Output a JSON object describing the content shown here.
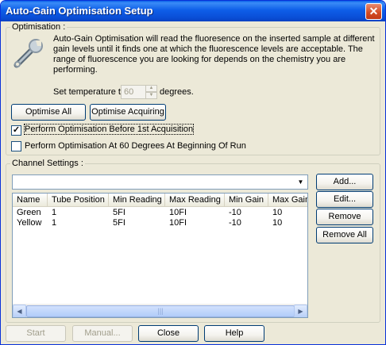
{
  "window": {
    "title": "Auto-Gain Optimisation Setup",
    "close_glyph": "✕"
  },
  "optimisation": {
    "group_label": "Optimisation :",
    "description": "Auto-Gain Optimisation will read the fluoresence on the inserted sample at different gain levels until it finds one at which the fluorescence levels are acceptable. The range of fluorescence you are looking for depends on the chemistry you are performing.",
    "temp_label": "Set temperature to",
    "temp_value": "60",
    "temp_units": "degrees.",
    "optimise_all": "Optimise All",
    "optimise_acquiring": "Optimise Acquiring",
    "check_before": {
      "label": "Perform Optimisation Before 1st Acquisition",
      "checked": true
    },
    "check_at_60": {
      "label": "Perform Optimisation At 60 Degrees At Beginning Of Run",
      "checked": false
    }
  },
  "channel": {
    "group_label": "Channel Settings :",
    "combo_value": "",
    "columns": [
      "Name",
      "Tube Position",
      "Min Reading",
      "Max Reading",
      "Min Gain",
      "Max Gain"
    ],
    "rows": [
      [
        "Green",
        "1",
        "5FI",
        "10FI",
        "-10",
        "10"
      ],
      [
        "Yellow",
        "1",
        "5FI",
        "10FI",
        "-10",
        "10"
      ]
    ],
    "add": "Add...",
    "edit": "Edit...",
    "remove": "Remove",
    "remove_all": "Remove All"
  },
  "footer": {
    "start": "Start",
    "manual": "Manual...",
    "close": "Close",
    "help": "Help"
  },
  "icons": {
    "wrench": "wrench-icon",
    "dropdown": "chevron-down-icon"
  }
}
